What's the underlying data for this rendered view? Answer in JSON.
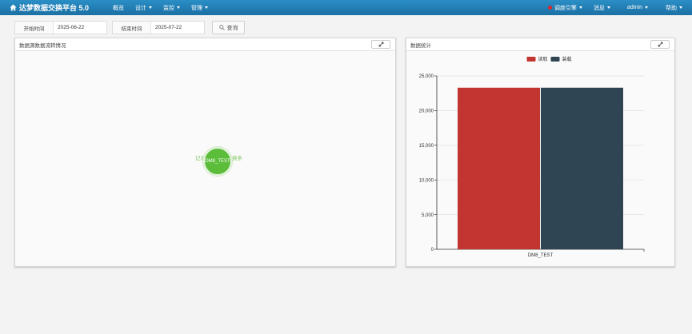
{
  "navbar": {
    "brand": "达梦数据交换平台 5.0",
    "menu": [
      {
        "label": "概览",
        "dropdown": false
      },
      {
        "label": "设计",
        "dropdown": true
      },
      {
        "label": "监控",
        "dropdown": true
      },
      {
        "label": "管理",
        "dropdown": true
      }
    ],
    "engine_label": "调度引擎",
    "messages_label": "消息",
    "user_label": "admin",
    "help_label": "帮助",
    "engine_status_color": "#e02424"
  },
  "search": {
    "start_label": "开始时间",
    "start_value": "2025-06-22",
    "end_label": "结束时间",
    "end_value": "2025-07-22",
    "query_label": "查询"
  },
  "flow_panel": {
    "title": "数据源数据流转情况",
    "node_label": "DM8_TEST",
    "left_side_label": "记录",
    "right_side_label": "换条"
  },
  "stats_panel": {
    "title": "数据统计"
  },
  "chart_data": {
    "type": "bar",
    "categories": [
      "DM8_TEST"
    ],
    "series": [
      {
        "name": "读取",
        "values": [
          23300
        ],
        "color": "#c23531"
      },
      {
        "name": "装载",
        "values": [
          23300
        ],
        "color": "#2f4554"
      }
    ],
    "ylim": [
      0,
      25000
    ],
    "yticks": [
      "0",
      "5,000",
      "10,000",
      "15,000",
      "20,000",
      "25,000"
    ],
    "ytick_values": [
      0,
      5000,
      10000,
      15000,
      20000,
      25000
    ],
    "grid": true,
    "legend_position": "top-center"
  }
}
